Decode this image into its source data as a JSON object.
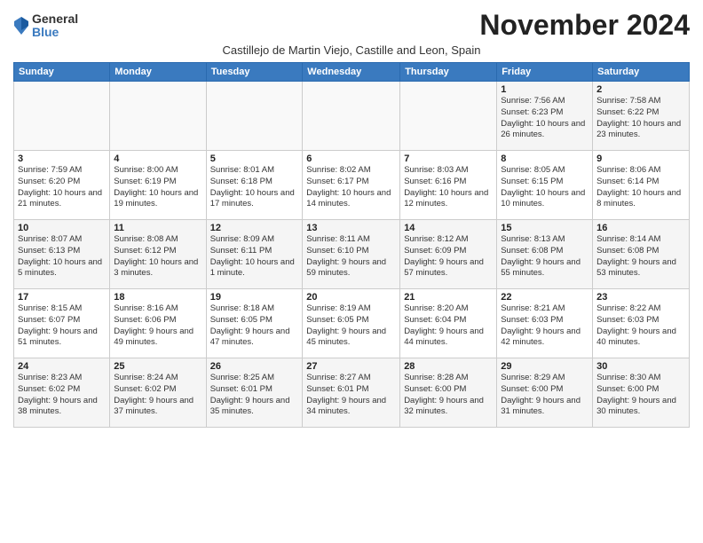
{
  "header": {
    "logo_general": "General",
    "logo_blue": "Blue",
    "title": "November 2024",
    "subtitle": "Castillejo de Martin Viejo, Castille and Leon, Spain"
  },
  "weekdays": [
    "Sunday",
    "Monday",
    "Tuesday",
    "Wednesday",
    "Thursday",
    "Friday",
    "Saturday"
  ],
  "weeks": [
    [
      {
        "day": "",
        "info": ""
      },
      {
        "day": "",
        "info": ""
      },
      {
        "day": "",
        "info": ""
      },
      {
        "day": "",
        "info": ""
      },
      {
        "day": "",
        "info": ""
      },
      {
        "day": "1",
        "info": "Sunrise: 7:56 AM\nSunset: 6:23 PM\nDaylight: 10 hours and 26 minutes."
      },
      {
        "day": "2",
        "info": "Sunrise: 7:58 AM\nSunset: 6:22 PM\nDaylight: 10 hours and 23 minutes."
      }
    ],
    [
      {
        "day": "3",
        "info": "Sunrise: 7:59 AM\nSunset: 6:20 PM\nDaylight: 10 hours and 21 minutes."
      },
      {
        "day": "4",
        "info": "Sunrise: 8:00 AM\nSunset: 6:19 PM\nDaylight: 10 hours and 19 minutes."
      },
      {
        "day": "5",
        "info": "Sunrise: 8:01 AM\nSunset: 6:18 PM\nDaylight: 10 hours and 17 minutes."
      },
      {
        "day": "6",
        "info": "Sunrise: 8:02 AM\nSunset: 6:17 PM\nDaylight: 10 hours and 14 minutes."
      },
      {
        "day": "7",
        "info": "Sunrise: 8:03 AM\nSunset: 6:16 PM\nDaylight: 10 hours and 12 minutes."
      },
      {
        "day": "8",
        "info": "Sunrise: 8:05 AM\nSunset: 6:15 PM\nDaylight: 10 hours and 10 minutes."
      },
      {
        "day": "9",
        "info": "Sunrise: 8:06 AM\nSunset: 6:14 PM\nDaylight: 10 hours and 8 minutes."
      }
    ],
    [
      {
        "day": "10",
        "info": "Sunrise: 8:07 AM\nSunset: 6:13 PM\nDaylight: 10 hours and 5 minutes."
      },
      {
        "day": "11",
        "info": "Sunrise: 8:08 AM\nSunset: 6:12 PM\nDaylight: 10 hours and 3 minutes."
      },
      {
        "day": "12",
        "info": "Sunrise: 8:09 AM\nSunset: 6:11 PM\nDaylight: 10 hours and 1 minute."
      },
      {
        "day": "13",
        "info": "Sunrise: 8:11 AM\nSunset: 6:10 PM\nDaylight: 9 hours and 59 minutes."
      },
      {
        "day": "14",
        "info": "Sunrise: 8:12 AM\nSunset: 6:09 PM\nDaylight: 9 hours and 57 minutes."
      },
      {
        "day": "15",
        "info": "Sunrise: 8:13 AM\nSunset: 6:08 PM\nDaylight: 9 hours and 55 minutes."
      },
      {
        "day": "16",
        "info": "Sunrise: 8:14 AM\nSunset: 6:08 PM\nDaylight: 9 hours and 53 minutes."
      }
    ],
    [
      {
        "day": "17",
        "info": "Sunrise: 8:15 AM\nSunset: 6:07 PM\nDaylight: 9 hours and 51 minutes."
      },
      {
        "day": "18",
        "info": "Sunrise: 8:16 AM\nSunset: 6:06 PM\nDaylight: 9 hours and 49 minutes."
      },
      {
        "day": "19",
        "info": "Sunrise: 8:18 AM\nSunset: 6:05 PM\nDaylight: 9 hours and 47 minutes."
      },
      {
        "day": "20",
        "info": "Sunrise: 8:19 AM\nSunset: 6:05 PM\nDaylight: 9 hours and 45 minutes."
      },
      {
        "day": "21",
        "info": "Sunrise: 8:20 AM\nSunset: 6:04 PM\nDaylight: 9 hours and 44 minutes."
      },
      {
        "day": "22",
        "info": "Sunrise: 8:21 AM\nSunset: 6:03 PM\nDaylight: 9 hours and 42 minutes."
      },
      {
        "day": "23",
        "info": "Sunrise: 8:22 AM\nSunset: 6:03 PM\nDaylight: 9 hours and 40 minutes."
      }
    ],
    [
      {
        "day": "24",
        "info": "Sunrise: 8:23 AM\nSunset: 6:02 PM\nDaylight: 9 hours and 38 minutes."
      },
      {
        "day": "25",
        "info": "Sunrise: 8:24 AM\nSunset: 6:02 PM\nDaylight: 9 hours and 37 minutes."
      },
      {
        "day": "26",
        "info": "Sunrise: 8:25 AM\nSunset: 6:01 PM\nDaylight: 9 hours and 35 minutes."
      },
      {
        "day": "27",
        "info": "Sunrise: 8:27 AM\nSunset: 6:01 PM\nDaylight: 9 hours and 34 minutes."
      },
      {
        "day": "28",
        "info": "Sunrise: 8:28 AM\nSunset: 6:00 PM\nDaylight: 9 hours and 32 minutes."
      },
      {
        "day": "29",
        "info": "Sunrise: 8:29 AM\nSunset: 6:00 PM\nDaylight: 9 hours and 31 minutes."
      },
      {
        "day": "30",
        "info": "Sunrise: 8:30 AM\nSunset: 6:00 PM\nDaylight: 9 hours and 30 minutes."
      }
    ]
  ]
}
